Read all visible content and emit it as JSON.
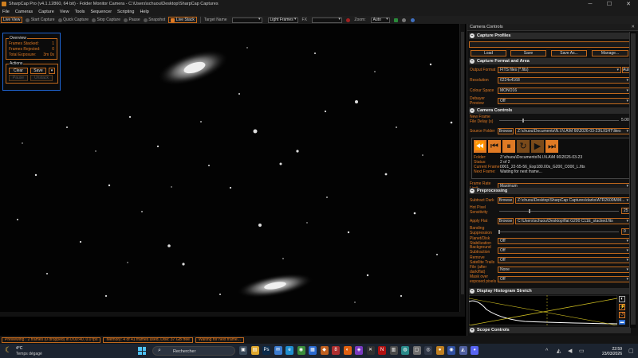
{
  "window": {
    "title": "SharpCap Pro (v4.1.12860, 64 bit) - Folder Monitor Camera - C:\\Users\\schuou\\Desktop\\SharpCap Captures",
    "minimize_glyph": "─",
    "maximize_glyph": "☐",
    "close_glyph": "✕"
  },
  "menu": [
    "File",
    "Cameras",
    "Capture",
    "View",
    "Tools",
    "Sequencer",
    "Scripting",
    "Help"
  ],
  "toolbar": {
    "live_view": "Live View",
    "start_capture": "Start Capture",
    "quick_capture": "Quick Capture",
    "stop_capture": "Stop Capture",
    "pause": "Pause",
    "snapshot": "Snapshot",
    "live_stack": "Live Stack",
    "target_name_label": "Target Name",
    "target_name_value": "",
    "frame_type": "Light Frames",
    "fx_label": "FX",
    "fx_value": "",
    "zoom_label": "Zoom:",
    "zoom_value": "Auto"
  },
  "overview": {
    "legend": "Overview",
    "rows": [
      {
        "label": "Frames Stacked:",
        "value": "1"
      },
      {
        "label": "Frames Rejected:",
        "value": "0"
      },
      {
        "label": "Total Exposure:",
        "value": "3m 0s"
      }
    ],
    "actions_legend": "Actions",
    "clear_label": "Clear",
    "save_label": "Save",
    "pause_label": "Pause",
    "unpause_label": "Unstack"
  },
  "camera_controls": {
    "panel_title": "Camera Controls",
    "profiles": {
      "header": "Capture Profiles",
      "load": "Load",
      "save": "Save",
      "save_as": "Save As...",
      "manage": "Manage..."
    },
    "format": {
      "header": "Capture Format and Area",
      "output_format_label": "Output Format",
      "output_format_value": "FITS files (*.fits)",
      "auto_label": "Auto",
      "resolution_label": "Resolution",
      "resolution_value": "6224x4168",
      "colour_space_label": "Colour Space",
      "colour_space_value": "MONO16",
      "debayer_label": "Debayer Preview",
      "debayer_value": "Off"
    },
    "camera": {
      "header": "Camera Controls",
      "new_frame_label": "New Frame File Delay (s)",
      "new_frame_value": "5.00",
      "new_frame_fraction": 0.2,
      "source_folder_label": "Source Folder",
      "browse_label": "Browse",
      "source_folder_value": "Z:\\chuou\\Documents\\N.I.N.A\\M 66\\2026-03-23\\LIGHT\\lites",
      "folder_label": "Folder:",
      "folder_value": "Z:\\chuou\\Documents\\N.I.N.A\\M 66\\2026-03-23",
      "status_label": "Status:",
      "status_value": "2 of 2",
      "current_frame_label": "Current Frame:",
      "current_frame_value": "0001_22-55-56_Exp180.00s_G200_O300_L.fits",
      "next_frame_label": "Next Frame:",
      "next_frame_value": "Waiting for next frame...",
      "frame_rate_label": "Frame Rate Limit",
      "frame_rate_value": "Maximum"
    },
    "preprocessing": {
      "header": "Preprocessing",
      "subtract_dark_label": "Subtract Dark",
      "browse_label": "Browse",
      "subtract_dark_value": "Z:\\chuou\\Desktop\\SharpCap Captures\\darks\\ATR2600M\\M...",
      "hot_pixel_label": "Hot Pixel Sensitivity",
      "hot_pixel_value": "25",
      "hot_pixel_fraction": 0.25,
      "apply_flat_label": "Apply Flat",
      "apply_flat_value": "C:\\Users\\schuou\\Desktop\\flat G200 C11E_stacked.fits",
      "banding_label": "Banding Suppression",
      "banding_value": "0",
      "banding_fraction": 0.0,
      "planet_label": "Planet/Disk Stabilization",
      "planet_value": "Off",
      "background_label": "Background Subtraction",
      "background_value": "Off",
      "satellite_label": "Remove Satellite Trails",
      "satellite_value": "Off",
      "file_label": "File (after dark/flat)",
      "file_value": "None",
      "mask_label": "Mask over exposed pixels",
      "mask_value": "Off"
    },
    "histogram": {
      "header": "Display Histogram Stretch"
    },
    "scope": {
      "header": "Scope Controls"
    }
  },
  "statusbar": {
    "previewing": "Previewing : 2 frames (0 dropped) in 0:00:40, 0.0 fps",
    "memory": "Memory: 4 of 41 frames used, Disk: 37 GB free",
    "waiting": "Waiting for next frame..."
  },
  "taskbar": {
    "temp": "4°C",
    "weather": "Temps dégagé",
    "search_placeholder": "Rechercher",
    "time": "22:59",
    "date": "23/03/2026",
    "apps": [
      {
        "name": "task-view",
        "glyph": "▣",
        "color": "#3a4a5a"
      },
      {
        "name": "explorer",
        "glyph": "▤",
        "color": "#e0a82e"
      },
      {
        "name": "photoshop",
        "glyph": "Ps",
        "color": "#0a2a4a"
      },
      {
        "name": "mail",
        "glyph": "✉",
        "color": "#3c7cd0"
      },
      {
        "name": "edge",
        "glyph": "e",
        "color": "#1f8fcf"
      },
      {
        "name": "chrome",
        "glyph": "◉",
        "color": "#3b8d3b"
      },
      {
        "name": "store",
        "glyph": "▦",
        "color": "#2a6ad0"
      },
      {
        "name": "app-orange",
        "glyph": "◆",
        "color": "#c06020"
      },
      {
        "name": "app-red",
        "glyph": "8",
        "color": "#b03030"
      },
      {
        "name": "firefox",
        "glyph": "◐",
        "color": "#e06010"
      },
      {
        "name": "app-purple",
        "glyph": "◈",
        "color": "#7a3ac0"
      },
      {
        "name": "app-x",
        "glyph": "✕",
        "color": "#303030"
      },
      {
        "name": "netflix",
        "glyph": "N",
        "color": "#b01010"
      },
      {
        "name": "app-grey",
        "glyph": "▥",
        "color": "#4a4a4a"
      },
      {
        "name": "app-teal",
        "glyph": "◍",
        "color": "#2a8a8a"
      },
      {
        "name": "app-white",
        "glyph": "▢",
        "color": "#707070"
      },
      {
        "name": "app-dark",
        "glyph": "◎",
        "color": "#303848"
      },
      {
        "name": "app-sharpcap",
        "glyph": "●",
        "color": "#c08020"
      },
      {
        "name": "app-blue",
        "glyph": "◉",
        "color": "#3050a0"
      },
      {
        "name": "app-shield",
        "glyph": "◭",
        "color": "#5060a0"
      },
      {
        "name": "discord",
        "glyph": "◕",
        "color": "#5865f2"
      }
    ]
  },
  "colors": {
    "accent_orange": "#e07a24",
    "border_orange": "#c0681c",
    "overview_border": "#1f64d0"
  }
}
